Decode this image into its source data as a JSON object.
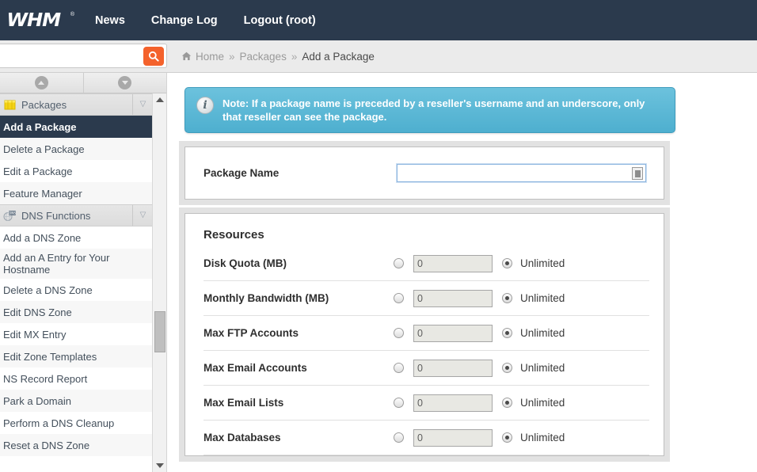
{
  "topnav": {
    "logo": "WHM",
    "logo_tm": "®",
    "items": [
      {
        "label": "News"
      },
      {
        "label": "Change Log"
      },
      {
        "label": "Logout (root)"
      }
    ]
  },
  "search": {
    "value": "",
    "placeholder": "",
    "icon": "search-icon"
  },
  "breadcrumb": {
    "home_icon": "home-icon",
    "items": [
      {
        "label": "Home",
        "current": false
      },
      {
        "label": "Packages",
        "current": false
      },
      {
        "label": "Add a Package",
        "current": true
      }
    ],
    "separator": "»"
  },
  "sidebar": {
    "tools": [
      {
        "icon": "collapse-all-icon",
        "direction": "up"
      },
      {
        "icon": "expand-all-icon",
        "direction": "down"
      }
    ],
    "groups": [
      {
        "label": "Packages",
        "icon": "packages-folder-icon",
        "chevron": "▽",
        "items": [
          {
            "label": "Add a Package",
            "active": true
          },
          {
            "label": "Delete a Package",
            "active": false
          },
          {
            "label": "Edit a Package",
            "active": false
          },
          {
            "label": "Feature Manager",
            "active": false
          }
        ]
      },
      {
        "label": "DNS Functions",
        "icon": "dns-globe-icon",
        "chevron": "▽",
        "items": [
          {
            "label": "Add a DNS Zone",
            "active": false
          },
          {
            "label": "Add an A Entry for Your Hostname",
            "active": false
          },
          {
            "label": "Delete a DNS Zone",
            "active": false
          },
          {
            "label": "Edit DNS Zone",
            "active": false
          },
          {
            "label": "Edit MX Entry",
            "active": false
          },
          {
            "label": "Edit Zone Templates",
            "active": false
          },
          {
            "label": "NS Record Report",
            "active": false
          },
          {
            "label": "Park a Domain",
            "active": false
          },
          {
            "label": "Perform a DNS Cleanup",
            "active": false
          },
          {
            "label": "Reset a DNS Zone",
            "active": false
          }
        ]
      }
    ]
  },
  "note": {
    "icon": "info-icon",
    "text": "Note: If a package name is preceded by a reseller's username and an underscore, only that reseller can see the package."
  },
  "package_name": {
    "label": "Package Name",
    "value": "",
    "placeholder": "",
    "autofill_icon": "autofill-icon"
  },
  "resources": {
    "title": "Resources",
    "unlimited_label": "Unlimited",
    "rows": [
      {
        "label": "Disk Quota (MB)",
        "value": "0",
        "value_selected": false,
        "unlimited_selected": true
      },
      {
        "label": "Monthly Bandwidth (MB)",
        "value": "0",
        "value_selected": false,
        "unlimited_selected": true
      },
      {
        "label": "Max FTP Accounts",
        "value": "0",
        "value_selected": false,
        "unlimited_selected": true
      },
      {
        "label": "Max Email Accounts",
        "value": "0",
        "value_selected": false,
        "unlimited_selected": true
      },
      {
        "label": "Max Email Lists",
        "value": "0",
        "value_selected": false,
        "unlimited_selected": true
      },
      {
        "label": "Max Databases",
        "value": "0",
        "value_selected": false,
        "unlimited_selected": true
      }
    ]
  },
  "colors": {
    "header_bg": "#2b3a4d",
    "accent_orange": "#f4622c",
    "note_blue": "#4eafcf",
    "active_item_bg": "#2b3a4d"
  }
}
